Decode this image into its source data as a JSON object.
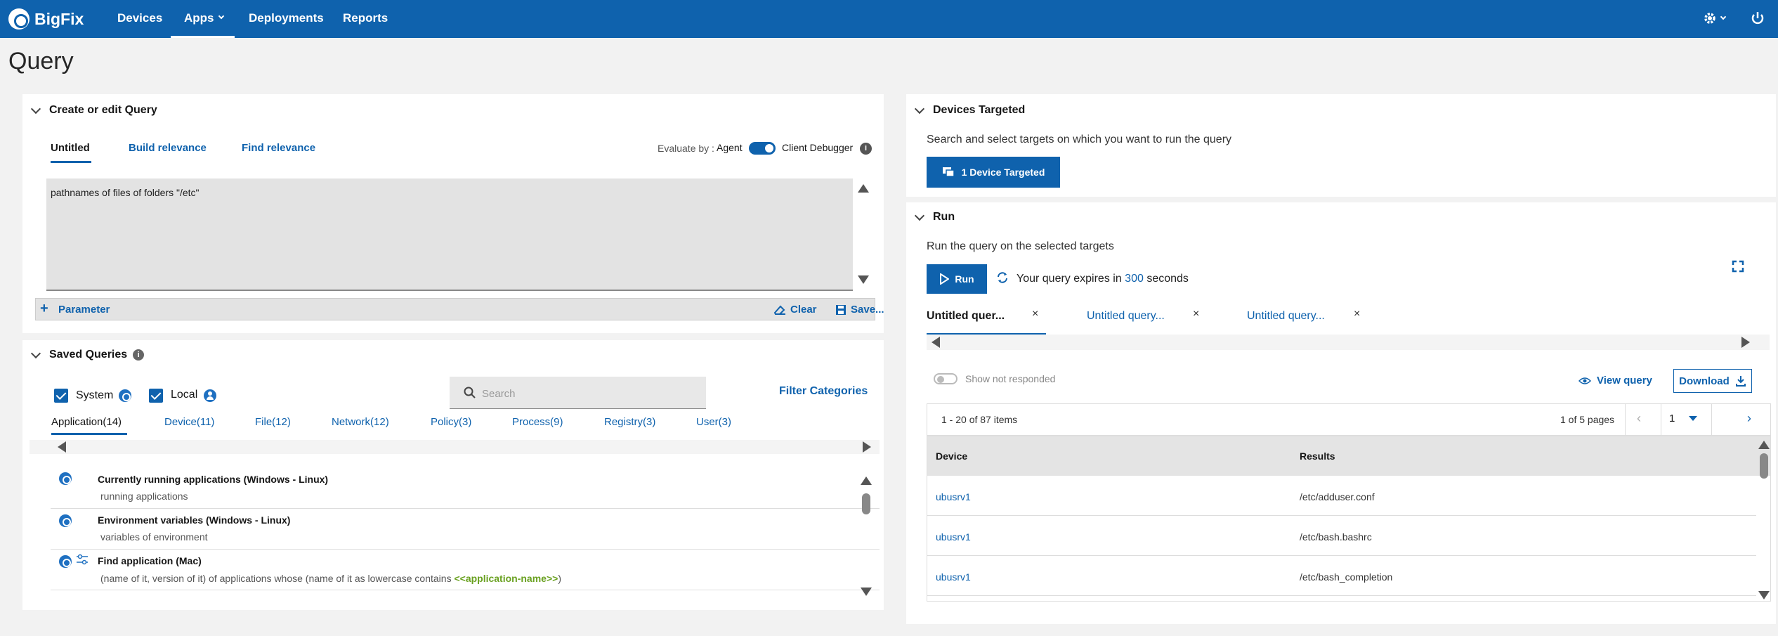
{
  "app": {
    "brand": "BigFix"
  },
  "nav": {
    "items": [
      {
        "label": "Devices"
      },
      {
        "label": "Apps"
      },
      {
        "label": "Deployments"
      },
      {
        "label": "Reports"
      }
    ]
  },
  "page": {
    "title": "Query"
  },
  "editor": {
    "section_title": "Create or edit Query",
    "tabs": [
      {
        "label": "Untitled"
      },
      {
        "label": "Build relevance"
      },
      {
        "label": "Find relevance"
      }
    ],
    "evaluate_by_label": "Evaluate by :",
    "agent_label": "Agent",
    "client_debugger_label": "Client Debugger",
    "query_text": "pathnames of files of folders \"/etc\"",
    "parameter_label": "Parameter",
    "clear_label": "Clear",
    "save_label": "Save..."
  },
  "saved": {
    "section_title": "Saved Queries",
    "system_label": "System",
    "local_label": "Local",
    "search_placeholder": "Search",
    "filter_label": "Filter Categories",
    "categories": [
      {
        "label": "Application(14)"
      },
      {
        "label": "Device(11)"
      },
      {
        "label": "File(12)"
      },
      {
        "label": "Network(12)"
      },
      {
        "label": "Policy(3)"
      },
      {
        "label": "Process(9)"
      },
      {
        "label": "Registry(3)"
      },
      {
        "label": "User(3)"
      }
    ],
    "items": [
      {
        "title": "Currently running applications (Windows - Linux)",
        "desc": "running applications"
      },
      {
        "title": "Environment variables (Windows - Linux)",
        "desc": "variables of environment"
      },
      {
        "title": "Find application (Mac)",
        "desc": "(name of it, version of it) of applications whose (name of it as lowercase contains ",
        "param": "<<application-name>>",
        "desc_end": ")"
      }
    ]
  },
  "devices": {
    "section_title": "Devices Targeted",
    "description": "Search and select targets on which you want to run the query",
    "button_label": "1 Device Targeted"
  },
  "run": {
    "section_title": "Run",
    "description": "Run the query on the selected targets",
    "button_label": "Run",
    "expires_prefix": "Your query expires in",
    "expires_value": "300",
    "expires_suffix": "seconds",
    "tabs": [
      {
        "label": "Untitled quer..."
      },
      {
        "label": "Untitled query..."
      },
      {
        "label": "Untitled query..."
      }
    ],
    "show_not_responded_label": "Show not responded",
    "view_query_label": "View query",
    "download_label": "Download",
    "items_summary": "1 - 20 of 87 items",
    "pages_summary": "1 of 5 pages",
    "current_page": "1",
    "columns": [
      "Device",
      "Results"
    ],
    "rows": [
      {
        "device": "ubusrv1",
        "result": "/etc/adduser.conf"
      },
      {
        "device": "ubusrv1",
        "result": "/etc/bash.bashrc"
      },
      {
        "device": "ubusrv1",
        "result": "/etc/bash_completion"
      }
    ]
  },
  "colors": {
    "brand": "#0f62ad",
    "param_green": "#6aa121"
  }
}
